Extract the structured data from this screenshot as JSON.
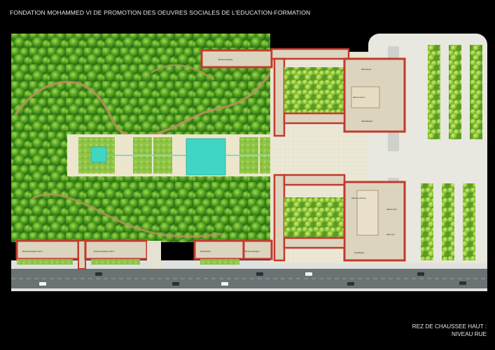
{
  "header": {
    "title": "FONDATION MOHAMMED VI DE PROMOTION DES OEUVRES SOCIALES DE L'EDUCATION-FORMATION"
  },
  "caption": {
    "line1": "REZ DE CHAUSSEE HAUT :",
    "line2": "NIVEAU RUE"
  },
  "plan_labels": {
    "bureaux_north": "Bureaux paysagers",
    "hall_accueil": "Hall d'accueil",
    "salle_reunion": "Salle de réunion",
    "salle_banquets": "Salle Banquets",
    "salle_conf": "Salle de conférence",
    "bureaux_sw1": "Bureaux paysagers entité 1",
    "bureaux_sw2": "Bureaux paysagers entité 2",
    "administration": "Administration",
    "bureaux_s3": "Bureaux paysagers",
    "amphitheatre": "Amphithéâtre",
    "salle_sport": "Salle de sport",
    "salle_multi": "Salle multi"
  },
  "colors": {
    "background": "#000000",
    "trees": "#3a8f1e",
    "lawn": "#6fa832",
    "paving": "#ece8d4",
    "pool": "#3fd6c4",
    "roof": "#c23a2e",
    "building": "#dcd4be",
    "road": "#cfd3d4",
    "street": "#5f6768"
  },
  "icons": [
    "tree-canopy",
    "car",
    "pool",
    "courtyard-garden"
  ]
}
